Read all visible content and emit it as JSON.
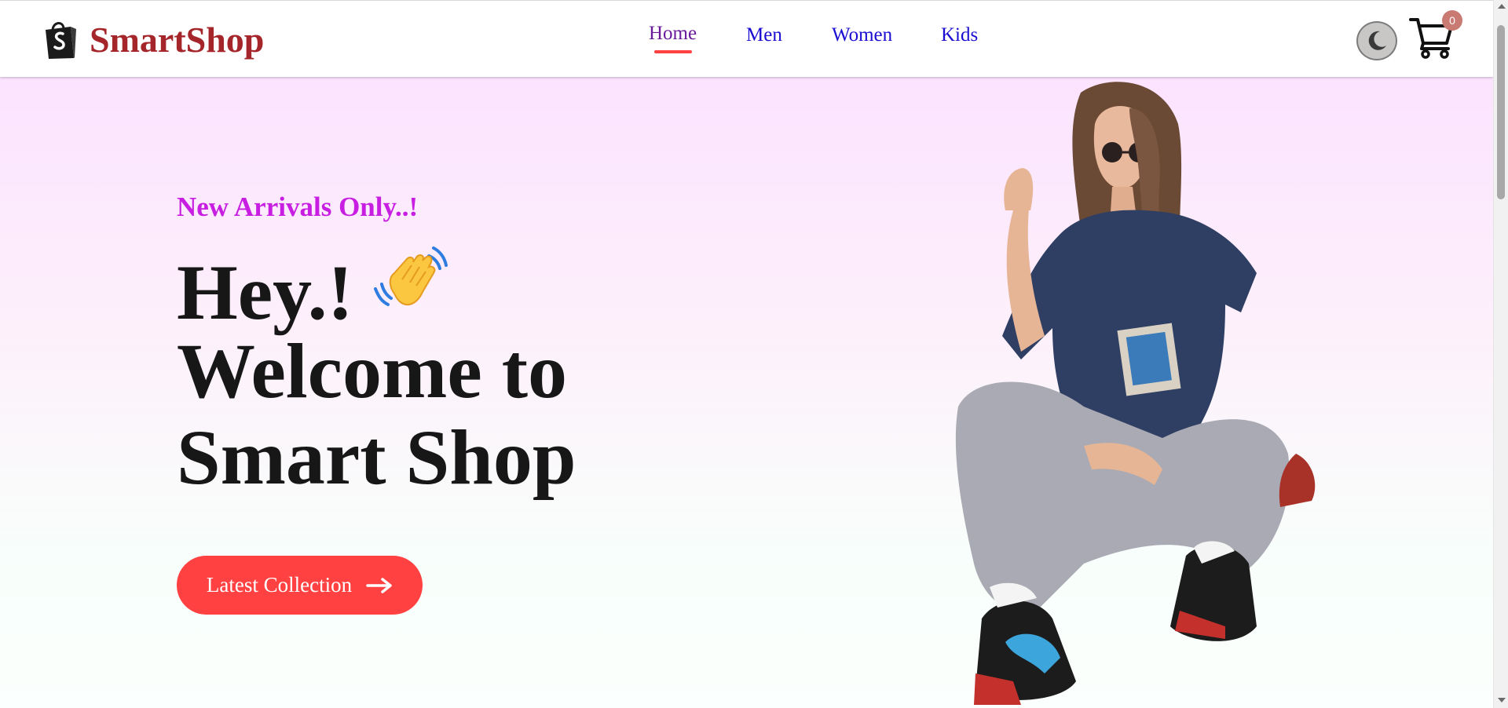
{
  "header": {
    "brand": "SmartShop",
    "nav": [
      {
        "label": "Home",
        "active": true
      },
      {
        "label": "Men",
        "active": false
      },
      {
        "label": "Women",
        "active": false
      },
      {
        "label": "Kids",
        "active": false
      }
    ],
    "cart_count": "0",
    "theme_icon": "moon-icon",
    "cart_icon": "cart-icon",
    "logo_icon": "shopping-bag-icon"
  },
  "hero": {
    "tagline": "New Arrivals Only..!",
    "headline": [
      "Hey.!",
      "Welcome to",
      "Smart Shop"
    ],
    "headline_emoji": "waving-hand-icon",
    "cta_label": "Latest Collection",
    "cta_icon": "arrow-right-icon"
  },
  "colors": {
    "brand": "#a5262a",
    "accent": "#ff4141",
    "tagline": "#c71ee2",
    "nav_link": "#1a0dd1"
  }
}
